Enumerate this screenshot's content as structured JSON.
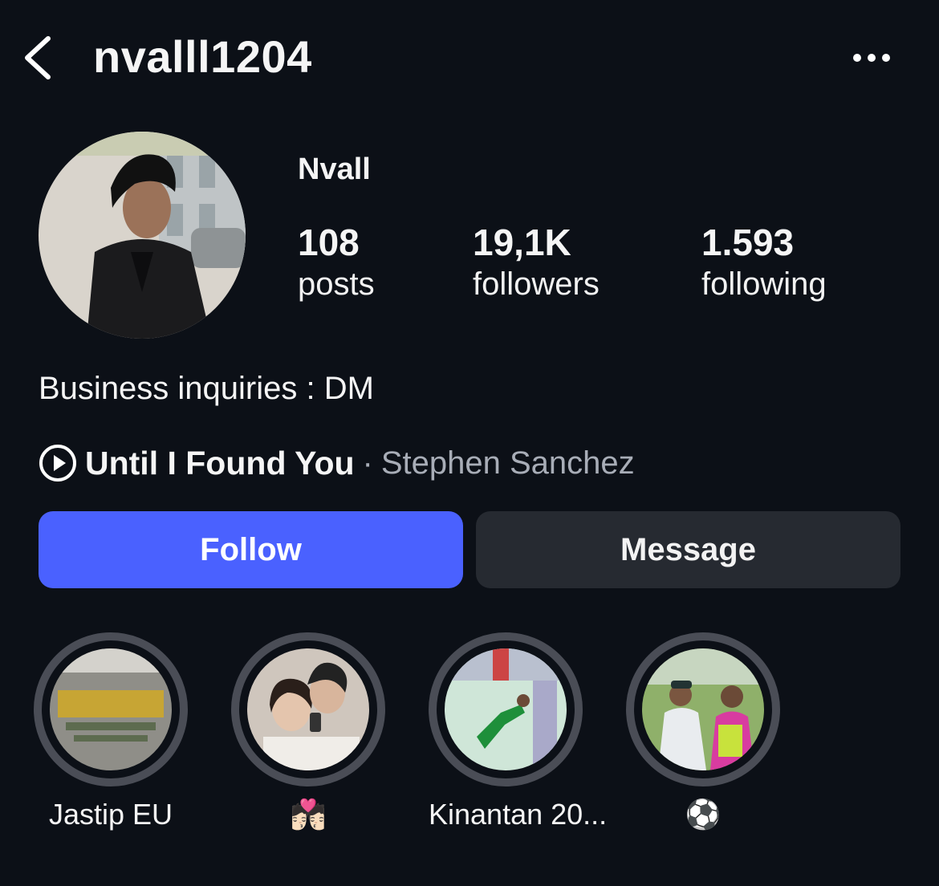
{
  "header": {
    "username": "nvalll1204"
  },
  "profile": {
    "display_name": "Nvall",
    "stats": [
      {
        "value": "108",
        "label": "posts"
      },
      {
        "value": "19,1K",
        "label": "followers"
      },
      {
        "value": "1.593",
        "label": "following"
      }
    ],
    "bio": "Business inquiries : DM",
    "music": {
      "song": "Until I Found You",
      "separator": "·",
      "artist": "Stephen Sanchez"
    }
  },
  "actions": {
    "follow_label": "Follow",
    "message_label": "Message"
  },
  "highlights": [
    {
      "caption": "Jastip EU"
    },
    {
      "caption": "💏🏻"
    },
    {
      "caption": "Kinantan 20..."
    },
    {
      "caption": "⚽"
    }
  ],
  "colors": {
    "background": "#0c1017",
    "follow_button": "#4a61ff",
    "message_button": "#262a31",
    "highlight_ring": "#4a4d56",
    "artist_text": "#a8adb7"
  },
  "icons": {
    "back": "chevron-left-icon",
    "more": "more-horizontal-icon",
    "music": "play-circle-icon"
  }
}
